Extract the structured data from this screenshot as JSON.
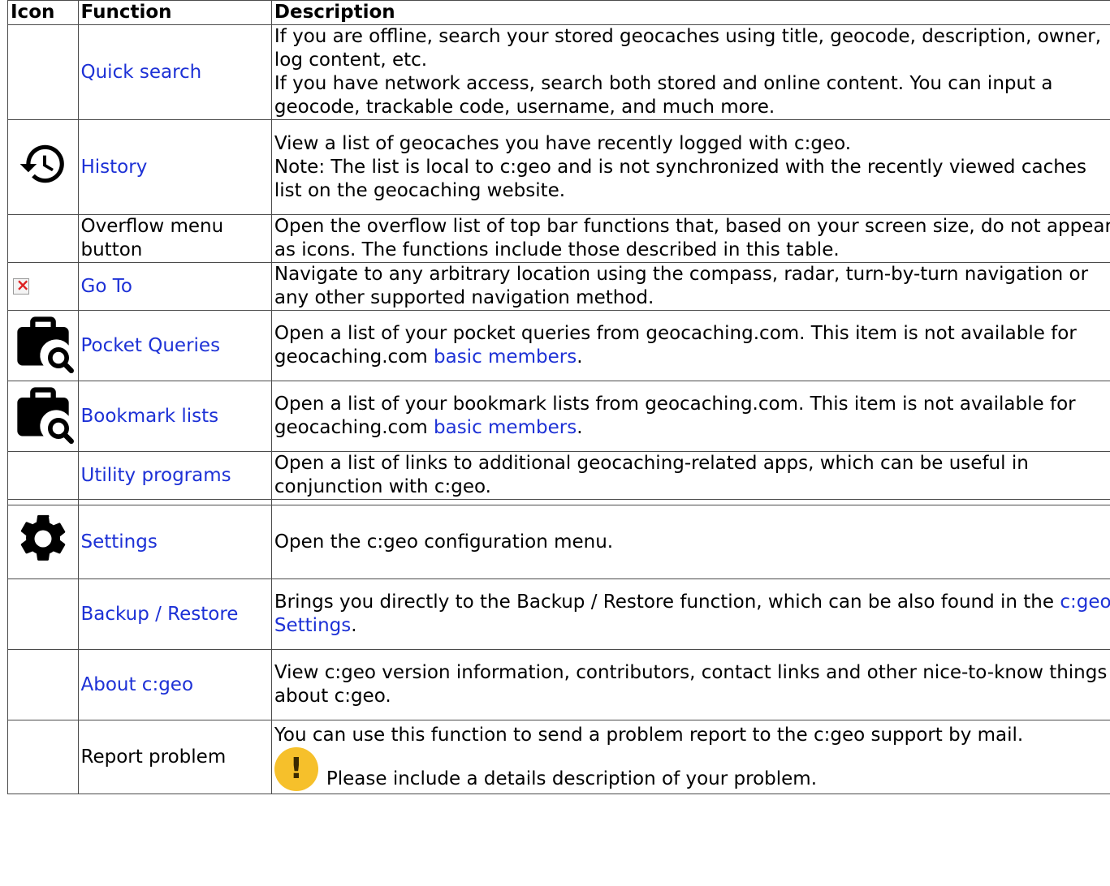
{
  "headers": {
    "icon": "Icon",
    "function": "Function",
    "description": "Description"
  },
  "rows": {
    "quick_search": {
      "function": "Quick search",
      "desc_line1": "If you are offline, search your stored geocaches using title, geocode, description, owner, log content, etc.",
      "desc_line2": "If you have network access, search both stored and online content. You can input a geocode, trackable code, username, and much more."
    },
    "history": {
      "icon": "history-icon",
      "function": "History",
      "desc_line1": "View a list of geocaches you have recently logged with c:geo.",
      "desc_line2": "Note: The list is local to c:geo and is not synchronized with the recently viewed caches list on the geocaching website."
    },
    "overflow": {
      "function": "Overflow menu button",
      "desc": "Open the overflow list of top bar functions that, based on your screen size, do not appear as icons. The functions include those described in this table."
    },
    "goto": {
      "icon": "broken-image-icon",
      "function": "Go To",
      "desc": "Navigate to any arbitrary location using the compass, radar, turn-by-turn navigation or any other supported navigation method."
    },
    "pocket_queries": {
      "icon": "briefcase-search-icon",
      "function": "Pocket Queries",
      "desc_before": "Open a list of your pocket queries from geocaching.com. This item is not available for geocaching.com ",
      "desc_link": "basic members",
      "desc_after": "."
    },
    "bookmark_lists": {
      "icon": "briefcase-search-icon",
      "function": "Bookmark lists",
      "desc_before": "Open a list of your bookmark lists from geocaching.com. This item is not available for geocaching.com ",
      "desc_link": "basic members",
      "desc_after": "."
    },
    "utility": {
      "function": "Utility programs",
      "desc": "Open a list of links to additional geocaching-related apps, which can be useful in conjunction with c:geo."
    },
    "settings": {
      "icon": "gear-icon",
      "function": "Settings",
      "desc": "Open the c:geo configuration menu."
    },
    "backup": {
      "function": "Backup / Restore",
      "desc_before": "Brings you directly to the Backup / Restore function, which can be also found in the ",
      "desc_link": "c:geo Settings",
      "desc_after": "."
    },
    "about": {
      "function": "About c:geo",
      "desc": "View c:geo version information, contributors, contact links and other nice-to-know things about c:geo."
    },
    "report": {
      "function": "Report problem",
      "desc_line1": "You can use this function to send a problem report to the c:geo support by mail.",
      "warning_icon": "exclamation-icon",
      "warning_glyph": "!",
      "desc_note": "Please include a details description of your problem."
    }
  },
  "colors": {
    "link": "#1d31d6",
    "border": "#4b4b4b",
    "warning": "#f6c02b"
  }
}
